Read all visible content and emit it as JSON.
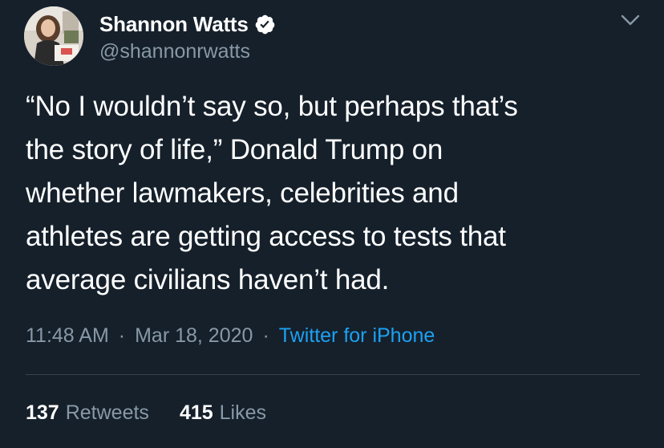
{
  "author": {
    "display_name": "Shannon Watts",
    "handle": "@shannonrwatts",
    "verified": true,
    "verified_icon": "verified-badge-icon",
    "avatar": "profile-photo"
  },
  "menu": {
    "icon": "chevron-down-icon"
  },
  "tweet": {
    "text_lines": [
      "“No I wouldn’t say so, but perhaps that’s",
      "the story of life,” Donald Trump on",
      "whether lawmakers, celebrities and",
      "athletes are getting access to tests that",
      "average civilians haven’t had."
    ],
    "time": "11:48 AM",
    "date": "Mar 18, 2020",
    "separator": "·",
    "source": "Twitter for iPhone"
  },
  "stats": {
    "retweets_count": "137",
    "retweets_label": "Retweets",
    "likes_count": "415",
    "likes_label": "Likes"
  },
  "colors": {
    "background": "#15202b",
    "primary_text": "#ffffff",
    "secondary_text": "#8899a6",
    "link": "#1da1f2",
    "divider": "#38444d"
  }
}
